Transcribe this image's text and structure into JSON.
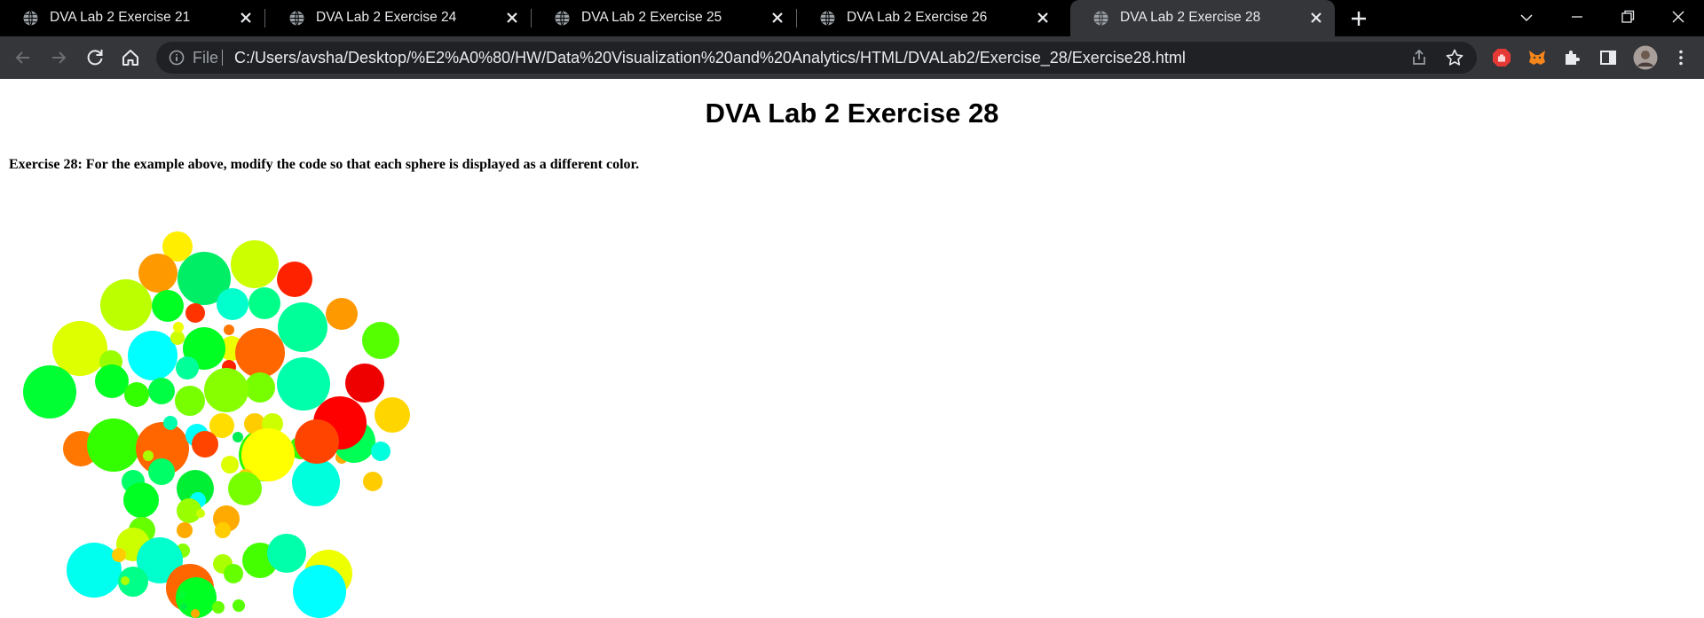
{
  "browser": {
    "tabs": [
      {
        "title": "DVA Lab 2 Exercise 21",
        "active": false
      },
      {
        "title": "DVA Lab 2 Exercise 24",
        "active": false
      },
      {
        "title": "DVA Lab 2 Exercise 25",
        "active": false
      },
      {
        "title": "DVA Lab 2 Exercise 26",
        "active": false
      },
      {
        "title": "DVA Lab 2 Exercise 28",
        "active": true
      }
    ],
    "address_bar": {
      "scheme_label": "File",
      "url": "C:/Users/avsha/Desktop/%E2%A0%80/HW/Data%20Visualization%20and%20Analytics/HTML/DVALab2/Exercise_28/Exercise28.html"
    },
    "icons": {
      "favicon": "globe-icon",
      "close": "close-icon",
      "new_tab": "plus-icon",
      "back": "arrow-left-icon",
      "forward": "arrow-right-icon",
      "reload": "reload-icon",
      "home": "home-icon",
      "info": "info-icon",
      "share": "share-icon",
      "bookmark": "star-icon",
      "extensions": [
        "adblock-icon",
        "metamask-icon",
        "puzzle-icon",
        "side-panel-icon",
        "profile-avatar-icon",
        "kebab-menu-icon"
      ]
    },
    "colors": {
      "tabstrip": "#000000",
      "toolbar": "#35363a",
      "omnibox": "#202124",
      "adblock": "#e53935",
      "metamask": "#f6851b"
    }
  },
  "page": {
    "title": "DVA Lab 2 Exercise 28",
    "exercise_text": "Exercise 28: For the example above, modify the code so that each sphere is displayed as a different color."
  },
  "chart_data": {
    "type": "bubble",
    "title": "",
    "note": "packed circles, each filled with a different color",
    "colors": [
      "#ffee00",
      "#ccff00",
      "#ff9900",
      "#00ee66",
      "#ff2200",
      "#bbff00",
      "#00ff22",
      "#00ffcc",
      "#00ff88",
      "#ff9900",
      "#ddff00",
      "#ff3300",
      "#00ff99",
      "#eeff00",
      "#00ffff",
      "#55ff00",
      "#99ff00",
      "#00ff22",
      "#ff6600",
      "#ccff00",
      "#ff7700",
      "#eeff00",
      "#ff2200",
      "#00ff99",
      "#00ffaa",
      "#00ff33",
      "#00ff22",
      "#77ff00",
      "#ee0000",
      "#00ff44",
      "#33ff00",
      "#88ff00",
      "#77ff00",
      "#ffd500",
      "#00ff88",
      "#ffaa00",
      "#ffcc00",
      "#00ff55",
      "#ff0000",
      "#ff7700",
      "#00ffdd",
      "#33ff00",
      "#ff6600",
      "#ffdd00",
      "#aaff00",
      "#00ffff",
      "#00ff66",
      "#00ffaa",
      "#22ff00",
      "#33ff00",
      "#00ff66",
      "#ddff00",
      "#ffcc00",
      "#ccff00",
      "#00ffdd",
      "#00ee33",
      "#ffff00",
      "#ffcc00",
      "#77ff00",
      "#ff4400",
      "#ff4400",
      "#00ffff",
      "#00ee55",
      "#00ff22",
      "#99ff00",
      "#66ff00",
      "#ffaa00",
      "#ffcc00",
      "#ffaa00",
      "#88ff00",
      "#ccff00",
      "#ccff00",
      "#00ffee",
      "#ffcc00",
      "#00ffcc",
      "#aaff00",
      "#66ff00",
      "#44ff00",
      "#00ff88",
      "#ff6600",
      "#00ffaa",
      "#eeff00",
      "#00ff22",
      "#00ffff",
      "#aaff00",
      "#00ee44",
      "#00ff33",
      "#66ff00",
      "#55ff00",
      "#ffaa00"
    ]
  }
}
